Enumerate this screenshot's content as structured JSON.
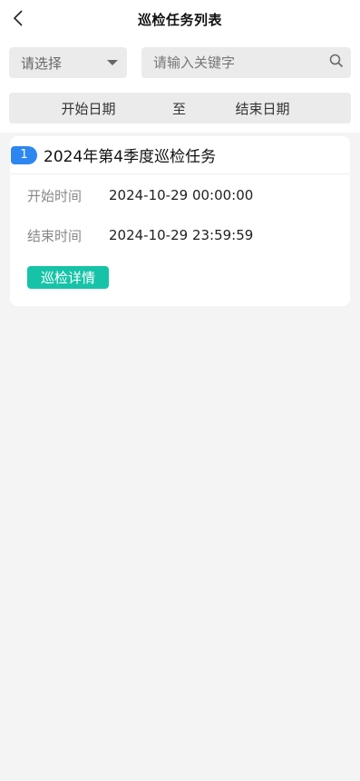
{
  "header": {
    "title": "巡检任务列表",
    "back_icon": "chevron-left-icon"
  },
  "filters": {
    "select_label": "请选择",
    "search_placeholder": "请输入关键字",
    "search_icon": "search-icon",
    "date_start": "开始日期",
    "date_separator": "至",
    "date_end": "结束日期"
  },
  "tasks": [
    {
      "index": "1",
      "title": "2024年第4季度巡检任务",
      "start_label": "开始时间",
      "start_value": "2024-10-29 00:00:00",
      "end_label": "结束时间",
      "end_value": "2024-10-29 23:59:59",
      "detail_label": "巡检详情"
    }
  ],
  "colors": {
    "badge": "#2e86f0",
    "detail_button": "#17c3a8",
    "background": "#f4f4f4"
  }
}
